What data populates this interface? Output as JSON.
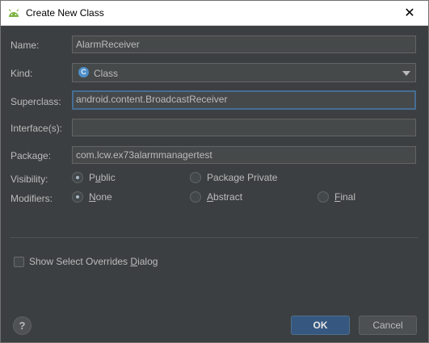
{
  "window": {
    "title": "Create New Class",
    "close_glyph": "✕",
    "app_icon": "android-icon"
  },
  "form": {
    "name": {
      "label": "Name:",
      "value": "AlarmReceiver"
    },
    "kind": {
      "label": "Kind:",
      "value": "Class",
      "icon_letter": "C",
      "icon": "class-icon"
    },
    "superclass": {
      "label": "Superclass:",
      "value": "android.content.BroadcastReceiver"
    },
    "interfaces": {
      "label": "Interface(s):",
      "value": ""
    },
    "package": {
      "label": "Package:",
      "value": "com.lcw.ex73alarmmanagertest"
    }
  },
  "visibility": {
    "label": "Visibility:",
    "options": [
      {
        "pre": "P",
        "mnemonic": "u",
        "post": "blic",
        "checked": true
      },
      {
        "pre": "Package Private",
        "mnemonic": "",
        "post": "",
        "checked": false
      }
    ]
  },
  "modifiers": {
    "label": "Modifiers:",
    "options": [
      {
        "pre": "",
        "mnemonic": "N",
        "post": "one",
        "checked": true
      },
      {
        "pre": "",
        "mnemonic": "A",
        "post": "bstract",
        "checked": false
      },
      {
        "pre": "",
        "mnemonic": "F",
        "post": "inal",
        "checked": false
      }
    ]
  },
  "overrides": {
    "pre": "Show Select Overrides ",
    "mnemonic": "D",
    "post": "ialog",
    "checked": false
  },
  "footer": {
    "help_glyph": "?",
    "ok_label": "OK",
    "cancel_label": "Cancel"
  },
  "colors": {
    "background": "#3c3f41",
    "text": "#bbbbbb",
    "focus": "#466d94",
    "ok_button": "#365880"
  }
}
